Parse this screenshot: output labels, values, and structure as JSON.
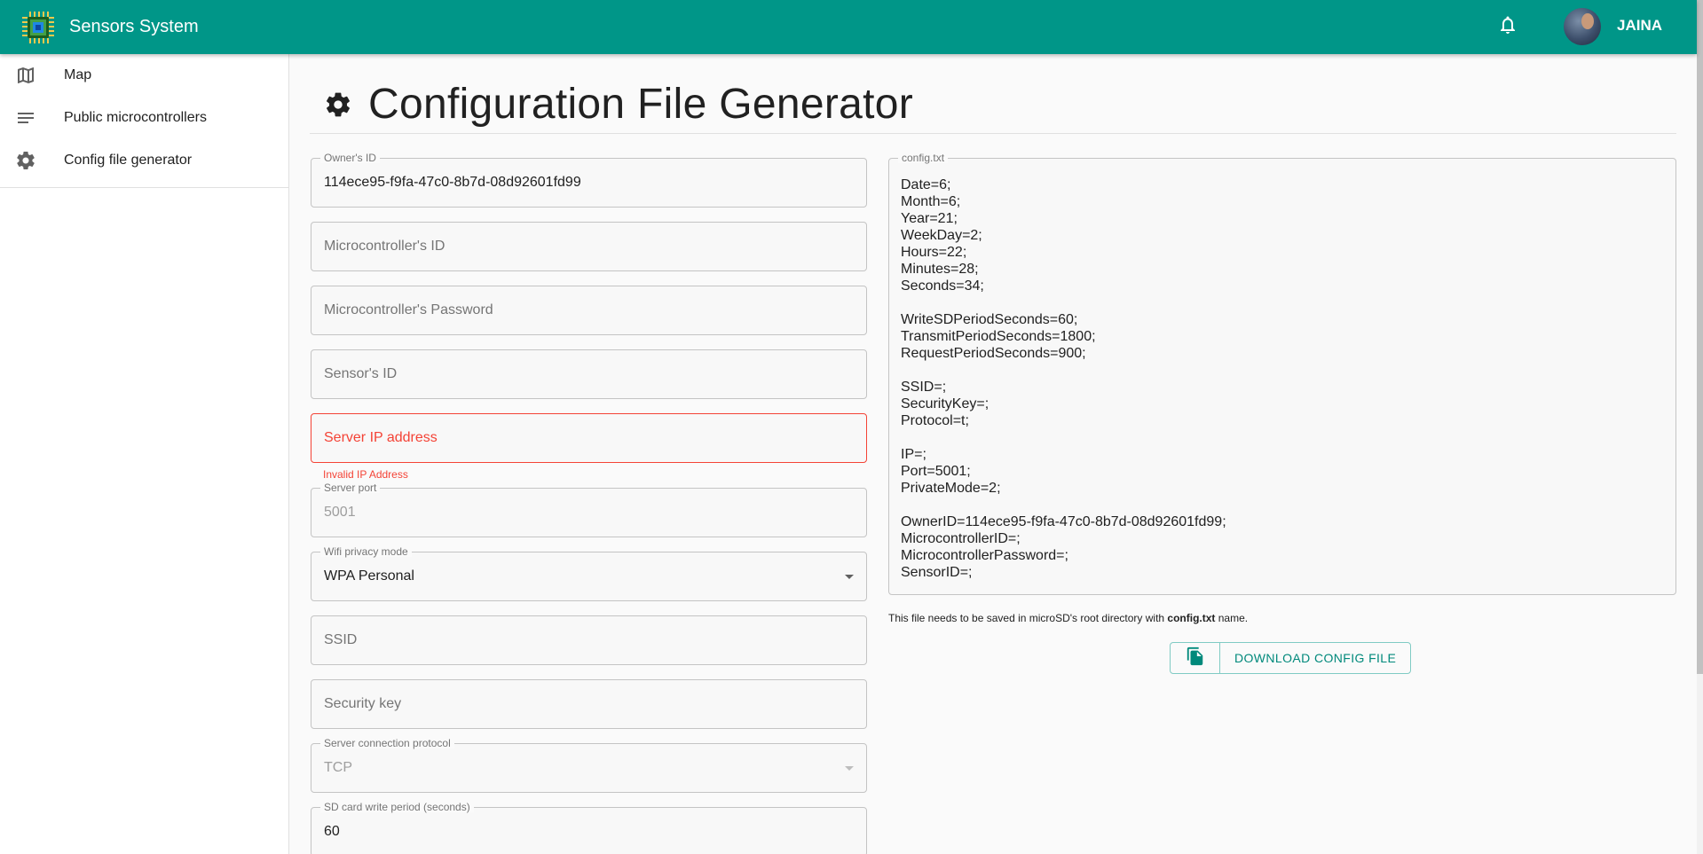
{
  "app": {
    "title": "Sensors System",
    "username": "JAINA"
  },
  "sidebar": {
    "items": [
      {
        "label": "Map",
        "icon": "map-icon"
      },
      {
        "label": "Public microcontrollers",
        "icon": "list-icon"
      },
      {
        "label": "Config file generator",
        "icon": "gear-icon"
      }
    ]
  },
  "page": {
    "title": "Configuration File Generator"
  },
  "form": {
    "owner_id": {
      "label": "Owner's ID",
      "value": "114ece95-f9fa-47c0-8b7d-08d92601fd99"
    },
    "microcontroller_id": {
      "placeholder": "Microcontroller's ID"
    },
    "microcontroller_password": {
      "placeholder": "Microcontroller's Password"
    },
    "sensor_id": {
      "placeholder": "Sensor's ID"
    },
    "server_ip": {
      "placeholder": "Server IP address",
      "error": "Invalid IP Address"
    },
    "server_port": {
      "label": "Server port",
      "value": "5001"
    },
    "wifi_privacy": {
      "label": "Wifi privacy mode",
      "value": "WPA Personal"
    },
    "ssid": {
      "placeholder": "SSID"
    },
    "security_key": {
      "placeholder": "Security key"
    },
    "protocol": {
      "label": "Server connection protocol",
      "value": "TCP"
    },
    "sd_write_period": {
      "label": "SD card write period (seconds)",
      "value": "60"
    }
  },
  "config": {
    "label": "config.txt",
    "text": "Date=6;\nMonth=6;\nYear=21;\nWeekDay=2;\nHours=22;\nMinutes=28;\nSeconds=34;\n\nWriteSDPeriodSeconds=60;\nTransmitPeriodSeconds=1800;\nRequestPeriodSeconds=900;\n\nSSID=;\nSecurityKey=;\nProtocol=t;\n\nIP=;\nPort=5001;\nPrivateMode=2;\n\nOwnerID=114ece95-f9fa-47c0-8b7d-08d92601fd99;\nMicrocontrollerID=;\nMicrocontrollerPassword=;\nSensorID=;",
    "note_prefix": "This file needs to be saved in microSD's root directory with ",
    "note_filename": "config.txt",
    "note_suffix": " name.",
    "download_label": "DOWNLOAD CONFIG FILE"
  },
  "colors": {
    "primary": "#009688",
    "error": "#f44336",
    "accent_text": "#00897b"
  }
}
